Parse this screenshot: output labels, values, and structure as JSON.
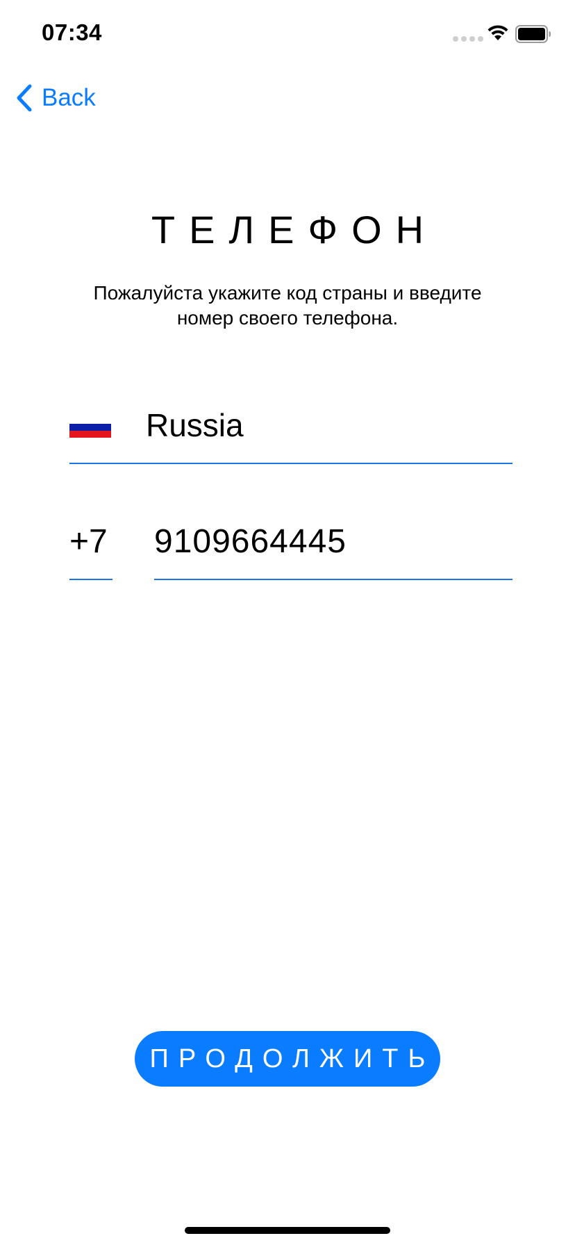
{
  "status_bar": {
    "time": "07:34"
  },
  "nav": {
    "back_label": "Back"
  },
  "page": {
    "title": "ТЕЛЕФОН",
    "subtitle_line1": "Пожалуйста укажите код страны и введите",
    "subtitle_line2": "номер своего телефона."
  },
  "country": {
    "name": "Russia",
    "flag_colors": [
      "#ffffff",
      "#0b1fa8",
      "#e5151c"
    ]
  },
  "phone": {
    "code": "+7",
    "number": "9109664445"
  },
  "actions": {
    "continue_label": "ПРОДОЛЖИТЬ"
  },
  "colors": {
    "accent": "#0a7cff",
    "underline": "#1a74e8"
  }
}
